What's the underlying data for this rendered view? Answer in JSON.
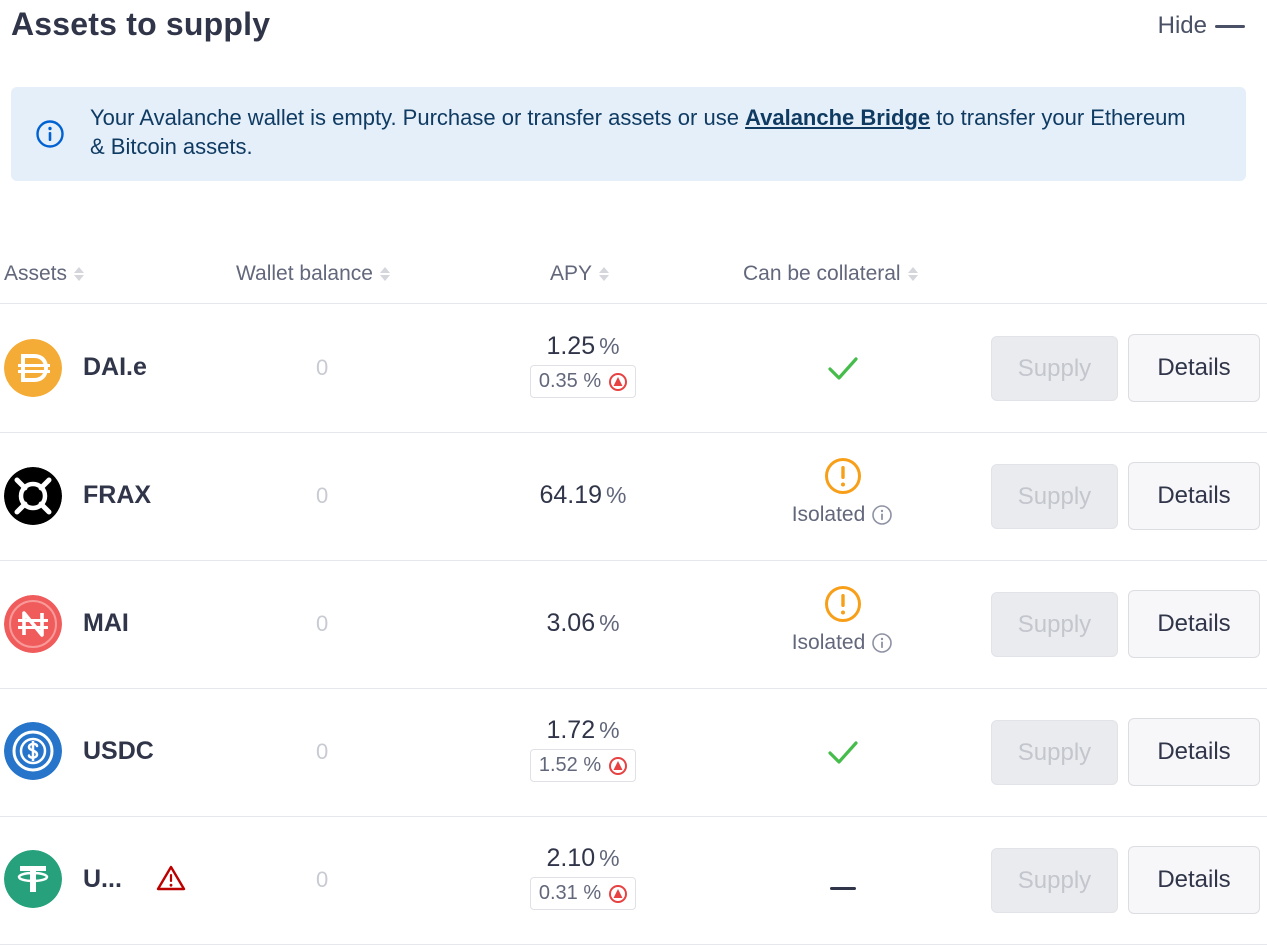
{
  "header": {
    "title": "Assets to supply",
    "hide_label": "Hide"
  },
  "banner": {
    "text_before": "Your Avalanche wallet is empty. Purchase or transfer assets or use ",
    "link": "Avalanche Bridge",
    "text_after": " to transfer your Ethereum & Bitcoin assets."
  },
  "table": {
    "columns": [
      "Assets",
      "Wallet balance",
      "APY",
      "Can be collateral"
    ],
    "supply_label": "Supply",
    "details_label": "Details",
    "isolated_label": "Isolated",
    "pct": "%",
    "rows": [
      {
        "name": "DAI.e",
        "balance": "0",
        "apy": "1.25",
        "incentive": "0.35",
        "collateral": "check"
      },
      {
        "name": "FRAX",
        "balance": "0",
        "apy": "64.19",
        "incentive": "",
        "collateral": "isolated"
      },
      {
        "name": "MAI",
        "balance": "0",
        "apy": "3.06",
        "incentive": "",
        "collateral": "isolated"
      },
      {
        "name": "USDC",
        "balance": "0",
        "apy": "1.72",
        "incentive": "1.52",
        "collateral": "check"
      },
      {
        "name": "U...",
        "balance": "0",
        "apy": "2.10",
        "incentive": "0.31",
        "collateral": "none"
      }
    ]
  },
  "colors": {
    "dai": "#F5AC37",
    "frax": "#000000",
    "mai": "#F05C5C",
    "usdc": "#2775CA",
    "usdt": "#26A17B",
    "check": "#46BC4B",
    "isolated": "#F89F1A",
    "warning": "#BC0000",
    "info": "#0062D2"
  }
}
